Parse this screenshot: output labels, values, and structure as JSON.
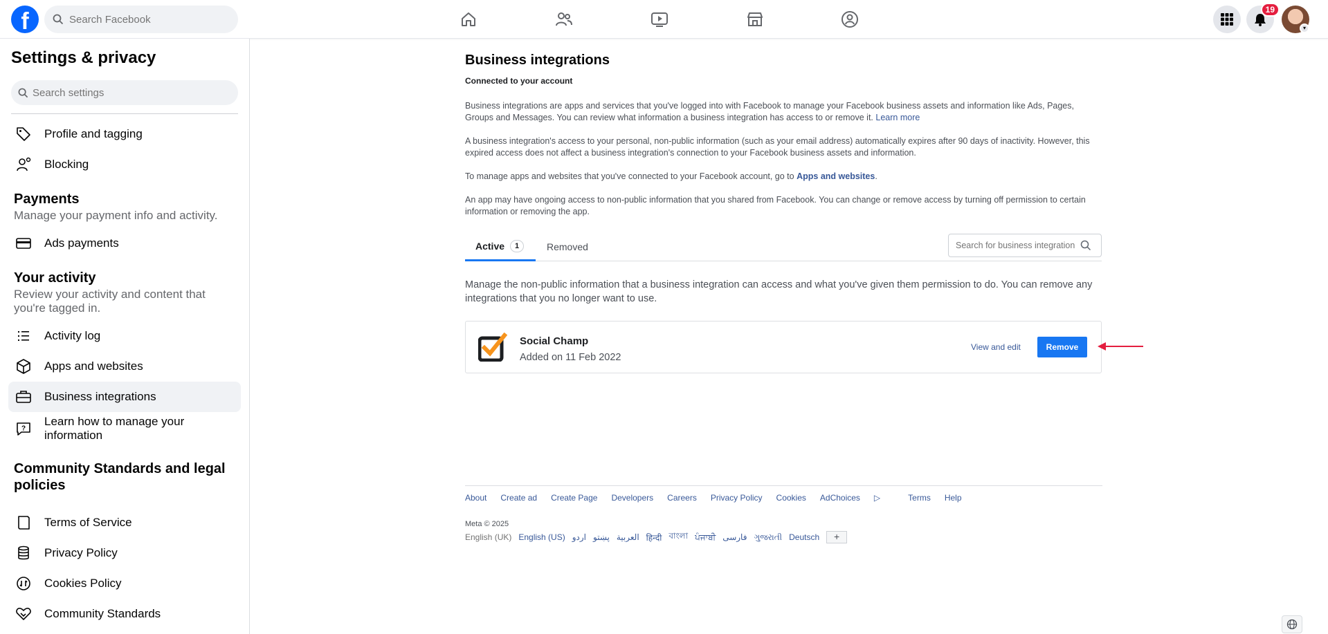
{
  "topbar": {
    "logo_letter": "f",
    "search_placeholder": "Search Facebook",
    "notification_count": "19"
  },
  "sidebar": {
    "title": "Settings & privacy",
    "search_placeholder": "Search settings",
    "items": [
      {
        "label": "Profile and tagging",
        "icon": "tag-icon"
      },
      {
        "label": "Blocking",
        "icon": "person-block-icon"
      },
      {
        "label": "Ads payments",
        "icon": "card-icon"
      },
      {
        "label": "Activity log",
        "icon": "list-icon"
      },
      {
        "label": "Apps and websites",
        "icon": "cube-icon"
      },
      {
        "label": "Business integrations",
        "icon": "briefcase-icon"
      },
      {
        "label": "Learn how to manage your information",
        "icon": "help-chat-icon"
      },
      {
        "label": "Terms of Service",
        "icon": "book-icon"
      },
      {
        "label": "Privacy Policy",
        "icon": "database-icon"
      },
      {
        "label": "Cookies Policy",
        "icon": "cookie-icon"
      },
      {
        "label": "Community Standards",
        "icon": "handshake-icon"
      }
    ],
    "payments": {
      "heading": "Payments",
      "sub": "Manage your payment info and activity."
    },
    "activity": {
      "heading": "Your activity",
      "sub": "Review your activity and content that you're tagged in."
    },
    "community": {
      "heading": "Community Standards and legal policies"
    }
  },
  "main": {
    "title": "Business integrations",
    "subtitle": "Connected to your account",
    "p1": "Business integrations are apps and services that you've logged into with Facebook to manage your Facebook business assets and information like Ads, Pages, Groups and Messages. You can review what information a business integration has access to or remove it.",
    "p1_link": "Learn more",
    "p2": "A business integration's access to your personal, non-public information (such as your email address) automatically expires after 90 days of inactivity. However, this expired access does not affect a business integration's connection to your Facebook business assets and information.",
    "p3": "To manage apps and websites that you've connected to your Facebook account, go to",
    "p3_link": "Apps and websites",
    "p4": "An app may have ongoing access to non-public information that you shared from Facebook. You can change or remove access by turning off permission to certain information or removing the app.",
    "tabs": {
      "active": "Active",
      "active_count": "1",
      "removed": "Removed"
    },
    "tab_search_placeholder": "Search for business integrations",
    "intro": "Manage the non-public information that a business integration can access and what you've given them permission to do. You can remove any integrations that you no longer want to use.",
    "integration": {
      "name": "Social Champ",
      "added": "Added on 11 Feb 2022",
      "view_edit": "View and edit",
      "remove": "Remove"
    }
  },
  "footer": {
    "links": [
      "About",
      "Create ad",
      "Create Page",
      "Developers",
      "Careers",
      "Privacy Policy",
      "Cookies",
      "AdChoices",
      "Terms",
      "Help"
    ],
    "meta": "Meta © 2025",
    "current_lang": "English (UK)",
    "langs": [
      "English (US)",
      "اردو",
      "پښتو",
      "العربية",
      "हिन्दी",
      "বাংলা",
      "ਪੰਜਾਬੀ",
      "فارسی",
      "ગુજરાતી",
      "Deutsch"
    ],
    "plus": "+"
  },
  "colors": {
    "accent": "#1877f2",
    "link": "#385898",
    "badge": "#e41e3f",
    "arrow": "#e41e3f"
  }
}
